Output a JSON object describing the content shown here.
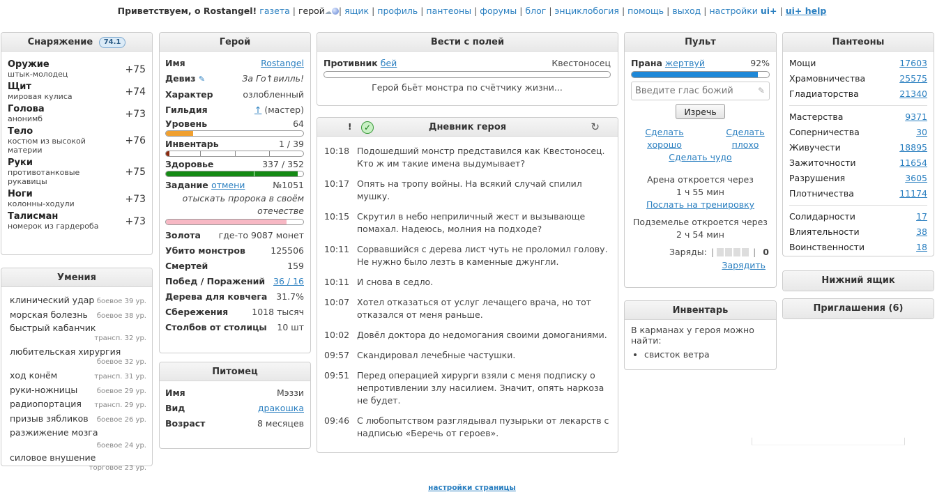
{
  "topbar": {
    "greeting": "Приветствуем, о Rostangel!",
    "links": [
      "газета",
      "герой",
      "ящик",
      "профиль",
      "пантеоны",
      "форумы",
      "блог",
      "энциклобогия",
      "помощь",
      "выход",
      "настройки"
    ],
    "uiplus": "ui+",
    "uihelp": "ui+ help"
  },
  "equip": {
    "title": "Снаряжение",
    "level": "74.1",
    "items": [
      {
        "slot": "Оружие",
        "name": "штык-молодец",
        "bonus": "+75"
      },
      {
        "slot": "Щит",
        "name": "мировая кулиса",
        "bonus": "+74"
      },
      {
        "slot": "Голова",
        "name": "анонимб",
        "bonus": "+73"
      },
      {
        "slot": "Тело",
        "name": "костюм из высокой материи",
        "bonus": "+76"
      },
      {
        "slot": "Руки",
        "name": "противотанковые рукавицы",
        "bonus": "+75"
      },
      {
        "slot": "Ноги",
        "name": "колонны-ходули",
        "bonus": "+73"
      },
      {
        "slot": "Талисман",
        "name": "номерок из гардероба",
        "bonus": "+73"
      }
    ]
  },
  "skills": {
    "title": "Умения",
    "items": [
      {
        "name": "клинический удар",
        "lvl": "боевое 39 ур."
      },
      {
        "name": "морская болезнь",
        "lvl": "боевое 38 ур."
      },
      {
        "name": "быстрый кабанчик",
        "lvl": "трансп. 32 ур."
      },
      {
        "name": "любительская хирургия",
        "lvl": "боевое 32 ур."
      },
      {
        "name": "ход конём",
        "lvl": "трансп. 31 ур."
      },
      {
        "name": "руки-ножницы",
        "lvl": "боевое 29 ур."
      },
      {
        "name": "радиопортация",
        "lvl": "трансп. 29 ур."
      },
      {
        "name": "призыв зябликов",
        "lvl": "боевое 26 ур."
      },
      {
        "name": "разжижение мозга",
        "lvl": "боевое 24 ур."
      },
      {
        "name": "силовое внушение",
        "lvl": "торговое 23 ур."
      }
    ]
  },
  "hero": {
    "title": "Герой",
    "name_k": "Имя",
    "name_v": "Rostangel",
    "motto_k": "Девиз",
    "motto_v": "За Го↑вилль!",
    "char_k": "Характер",
    "char_v": "озлобленный",
    "guild_k": "Гильдия",
    "guild_sym": "↑",
    "guild_v": "(мастер)",
    "level_k": "Уровень",
    "level_v": "64",
    "level_pct": 0.2,
    "inv_k": "Инвентарь",
    "inv_v": "1 / 39",
    "inv_pct": 0.026,
    "hp_k": "Здоровье",
    "hp_v": "337 / 352",
    "hp_pct": 0.957,
    "quest_k": "Задание",
    "quest_cancel": "отмени",
    "quest_num": "№1051",
    "quest_text": "отыскать пророка в своём отечестве",
    "quest_pct": 0.88,
    "gold_k": "Золота",
    "gold_v": "где-то 9087 монет",
    "kills_k": "Убито монстров",
    "kills_v": "125506",
    "deaths_k": "Смертей",
    "deaths_v": "159",
    "wins_k": "Побед / Поражений",
    "wins_v": "36 / 16",
    "ark_k": "Дерева для ковчега",
    "ark_v": "31.7%",
    "save_k": "Сбережения",
    "save_v": "1018 тысяч",
    "pillars_k": "Столбов от столицы",
    "pillars_v": "10 шт"
  },
  "pet": {
    "title": "Питомец",
    "name_k": "Имя",
    "name_v": "Мэззи",
    "type_k": "Вид",
    "type_v": "дракошка",
    "age_k": "Возраст",
    "age_v": "8 месяцев"
  },
  "news": {
    "title": "Вести с полей",
    "enemy_k": "Противник",
    "enemy_act": "бей",
    "enemy_name": "Квестоносец",
    "enemy_pct": 0,
    "msg": "Герой бьёт монстра по счётчику жизни..."
  },
  "diary": {
    "title": "Дневник героя",
    "excl": "!",
    "entries": [
      {
        "t": "10:18",
        "m": "Подошедший монстр представился как Квестоносец. Кто ж им такие имена выдумывает?"
      },
      {
        "t": "10:17",
        "m": "Опять на тропу войны. На всякий случай спилил мушку."
      },
      {
        "t": "10:15",
        "m": "Скрутил в небо неприличный жест и вызывающе помахал. Надеюсь, молния на подходе?"
      },
      {
        "t": "10:11",
        "m": "Сорвавшийся с дерева лист чуть не проломил голову. Не нужно было лезть в каменные джунгли."
      },
      {
        "t": "10:11",
        "m": "И снова в седло."
      },
      {
        "t": "10:07",
        "m": "Хотел отказаться от услуг лечащего врача, но тот отказался от меня раньше."
      },
      {
        "t": "10:02",
        "m": "Довёл доктора до недомогания своими домоганиями."
      },
      {
        "t": "09:57",
        "m": "Скандировал лечебные частушки."
      },
      {
        "t": "09:51",
        "m": "Перед операцией хирурги взяли с меня подписку о непротивлении злу насилием. Значит, опять наркоза не будет."
      },
      {
        "t": "09:46",
        "m": "С любопытством разглядывал пузырьки от лекарств с надписью «Беречь от героев»."
      }
    ]
  },
  "remote": {
    "title": "Пульт",
    "prana_k": "Прана",
    "prana_act": "жертвуй",
    "prana_v": "92%",
    "prana_pct": 0.92,
    "placeholder": "Введите глас божий",
    "say_btn": "Изречь",
    "good": "Сделать хорошо",
    "bad": "Сделать плохо",
    "miracle": "Сделать чудо",
    "arena": "Арена откроется через",
    "arena_time": "1 ч 55 мин",
    "train": "Послать на тренировку",
    "dungeon": "Подземелье откроется через",
    "dungeon_time": "2 ч 54 мин",
    "charges_k": "Заряды:",
    "charges_v": "0",
    "recharge": "Зарядить"
  },
  "inventory": {
    "title": "Инвентарь",
    "intro": "В карманах у героя можно найти:",
    "items": [
      "свисток ветра"
    ]
  },
  "pantheons": {
    "title": "Пантеоны",
    "groups": [
      [
        {
          "n": "Мощи",
          "v": "17603"
        },
        {
          "n": "Храмовничества",
          "v": "25575"
        },
        {
          "n": "Гладиаторства",
          "v": "21340"
        }
      ],
      [
        {
          "n": "Мастерства",
          "v": "9371"
        },
        {
          "n": "Соперничества",
          "v": "30"
        },
        {
          "n": "Живучести",
          "v": "18895"
        },
        {
          "n": "Зажиточности",
          "v": "11654"
        },
        {
          "n": "Разрушения",
          "v": "3605"
        },
        {
          "n": "Плотничества",
          "v": "11174"
        }
      ],
      [
        {
          "n": "Солидарности",
          "v": "17"
        },
        {
          "n": "Влиятельности",
          "v": "38"
        },
        {
          "n": "Воинственности",
          "v": "18"
        }
      ]
    ]
  },
  "lowerbox": {
    "title": "Нижний ящик"
  },
  "invites": {
    "title": "Приглашения (6)"
  },
  "footer": {
    "settings": "настройки страницы"
  },
  "colors": {
    "level": "#f0a030",
    "health": "#148a14",
    "quest": "#f7b8c4",
    "prana": "#1e88d8",
    "accent": "#2a7fc0"
  }
}
